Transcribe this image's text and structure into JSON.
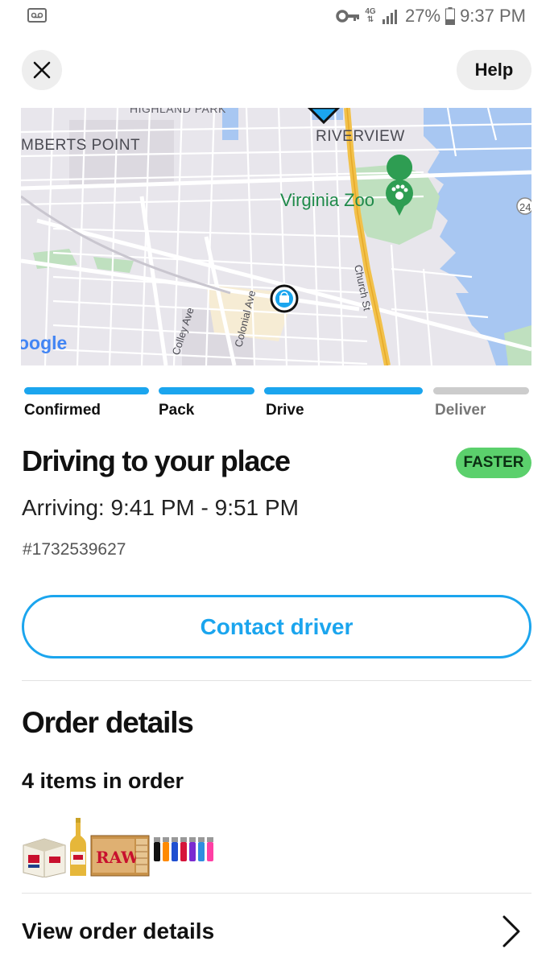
{
  "status_bar": {
    "network": "4G",
    "battery": "27%",
    "time": "9:37 PM"
  },
  "header": {
    "help_label": "Help"
  },
  "map": {
    "labels": {
      "highland_park": "HIGHLAND PARK",
      "lamberts_point": "MBERTS POINT",
      "riverview": "RIVERVIEW",
      "virginia_zoo": "Virginia Zoo",
      "church_st": "Church St",
      "colley_ave": "Colley Ave",
      "colonial_ave": "Colonial Ave",
      "google": "oogle",
      "route": "24"
    }
  },
  "progress": {
    "steps": [
      {
        "label": "Confirmed",
        "done": true
      },
      {
        "label": "Pack",
        "done": true
      },
      {
        "label": "Drive",
        "done": true
      },
      {
        "label": "Deliver",
        "done": false
      }
    ],
    "active_color": "#1ba5ee",
    "inactive_color": "#cccccc"
  },
  "order_status": {
    "title": "Driving to your place",
    "badge": "FASTER",
    "arriving": "Arriving: 9:41 PM - 9:51 PM",
    "order_number": "#1732539627"
  },
  "contact_driver_label": "Contact driver",
  "order_details": {
    "heading": "Order details",
    "items_count": "4 items in order",
    "thumbnails": [
      "beer-case",
      "beer-bottle",
      "rolling-papers-box",
      "lighters"
    ],
    "raw_label": "RAW",
    "view_details_label": "View order details"
  }
}
